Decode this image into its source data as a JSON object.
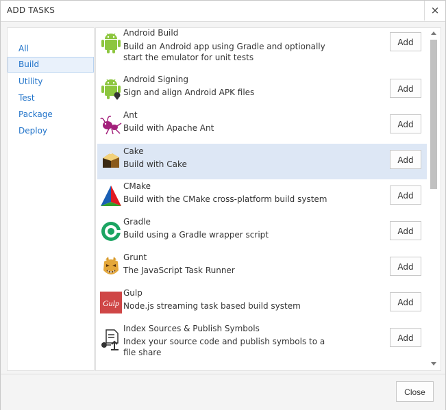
{
  "dialog": {
    "title": "ADD TASKS",
    "close_glyph": "×",
    "footer_close_label": "Close"
  },
  "nav": {
    "items": [
      {
        "label": "All",
        "selected": false
      },
      {
        "label": "Build",
        "selected": true
      },
      {
        "label": "Utility",
        "selected": false
      },
      {
        "label": "Test",
        "selected": false
      },
      {
        "label": "Package",
        "selected": false
      },
      {
        "label": "Deploy",
        "selected": false
      }
    ]
  },
  "tasks": [
    {
      "name": "Android Build",
      "description": "Build an Android app using Gradle and optionally start the emulator for unit tests",
      "icon": "android-icon",
      "add_label": "Add",
      "highlighted": false
    },
    {
      "name": "Android Signing",
      "description": "Sign and align Android APK files",
      "icon": "android-signing-icon",
      "add_label": "Add",
      "highlighted": false
    },
    {
      "name": "Ant",
      "description": "Build with Apache Ant",
      "icon": "ant-icon",
      "add_label": "Add",
      "highlighted": false
    },
    {
      "name": "Cake",
      "description": "Build with Cake",
      "icon": "cake-icon",
      "add_label": "Add",
      "highlighted": true
    },
    {
      "name": "CMake",
      "description": "Build with the CMake cross-platform build system",
      "icon": "cmake-icon",
      "add_label": "Add",
      "highlighted": false
    },
    {
      "name": "Gradle",
      "description": "Build using a Gradle wrapper script",
      "icon": "gradle-icon",
      "add_label": "Add",
      "highlighted": false
    },
    {
      "name": "Grunt",
      "description": "The JavaScript Task Runner",
      "icon": "grunt-icon",
      "add_label": "Add",
      "highlighted": false
    },
    {
      "name": "Gulp",
      "description": "Node.js streaming task based build system",
      "icon": "gulp-icon",
      "add_label": "Add",
      "highlighted": false
    },
    {
      "name": "Index Sources & Publish Symbols",
      "description": "Index your source code and publish symbols to a file share",
      "icon": "index-symbols-icon",
      "add_label": "Add",
      "highlighted": false
    }
  ],
  "icon_text": {
    "gulp": "Gulp"
  },
  "colors": {
    "link_blue": "#1f72c9",
    "android_green": "#8cc63e",
    "highlight_row": "#dde7f5",
    "ant_magenta": "#a3207b",
    "gulp_red": "#cf4646",
    "gradle_green": "#1ba462"
  }
}
